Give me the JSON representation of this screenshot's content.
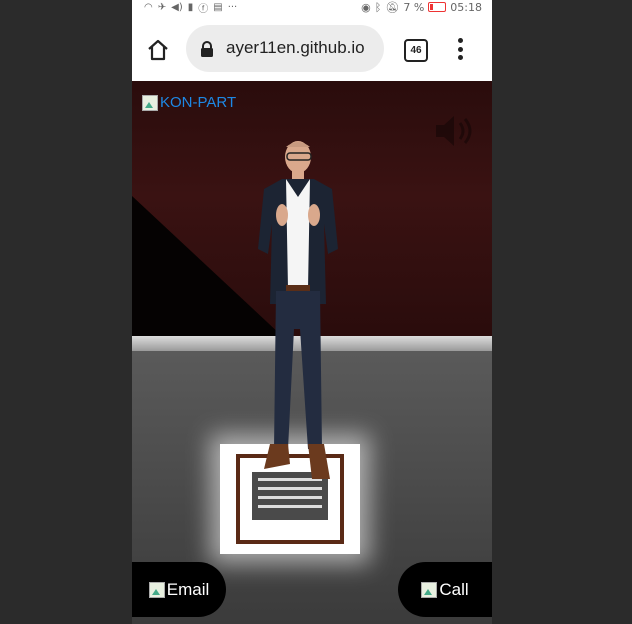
{
  "status_bar": {
    "left_icons": [
      "wifi-icon",
      "airplane-icon",
      "volume-icon",
      "video-icon",
      "facebook-icon",
      "calendar-icon",
      "more-icon"
    ],
    "right_icons": [
      "eye-icon",
      "bluetooth-icon",
      "mute-icon"
    ],
    "battery_text": "7 %",
    "time": "05:18"
  },
  "browser": {
    "url": "ayer11en.github.io",
    "tab_count": "46"
  },
  "page": {
    "logo_alt": "KON-PART",
    "email_label": "Email",
    "call_label": "Call",
    "accent_link": "#1e88e5"
  }
}
